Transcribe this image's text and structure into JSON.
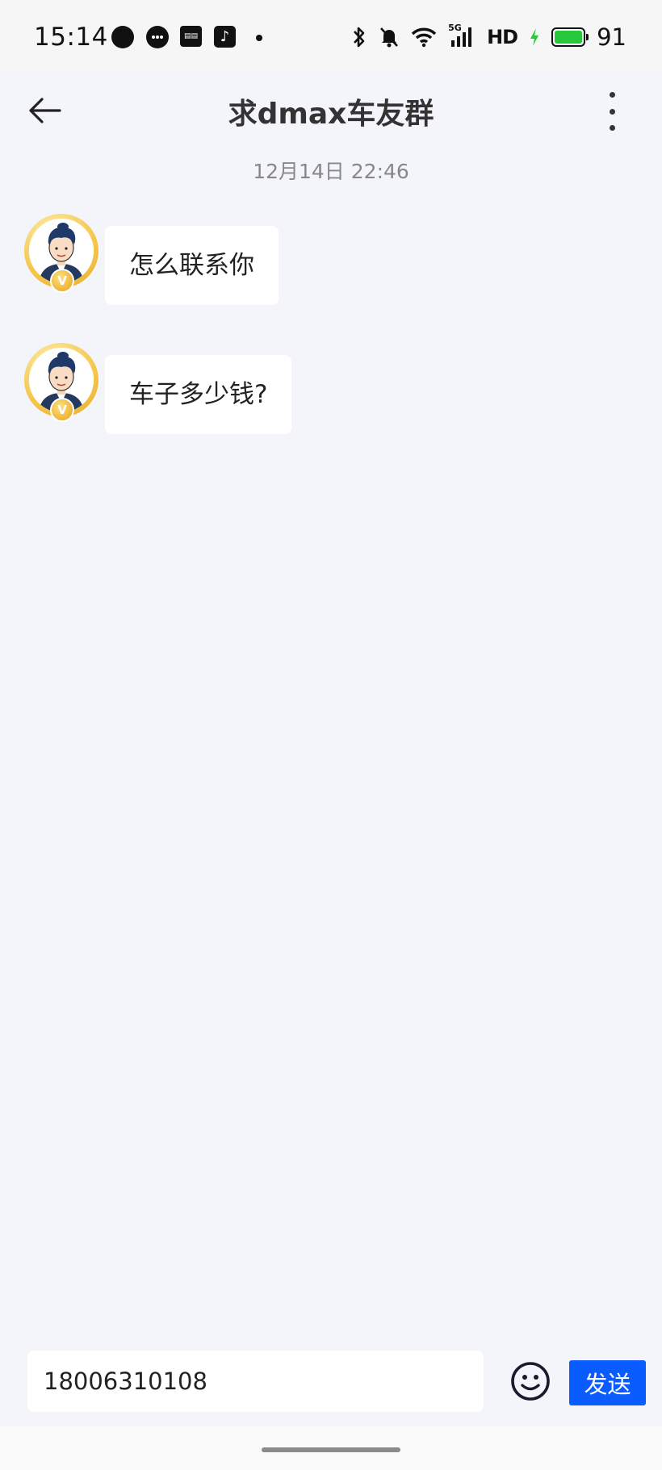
{
  "status_bar": {
    "time": "15:14",
    "notifications": [
      "chat-bubble-icon",
      "message-icon",
      "news-icon",
      "tiktok-icon",
      "more-dot-icon"
    ],
    "network": "5G",
    "hd_label": "HD",
    "battery_percent": "91",
    "battery_color": "#27c93a"
  },
  "header": {
    "title": "求dmax车友群",
    "back_icon": "back-arrow-icon",
    "more_icon": "more-vertical-icon"
  },
  "conversation": {
    "timestamp": "12月14日 22:46",
    "messages": [
      {
        "text": "怎么联系你",
        "badge": "V"
      },
      {
        "text": "车子多少钱?",
        "badge": "V"
      }
    ]
  },
  "composer": {
    "input_value": "18006310108",
    "emoji_icon": "smiley-icon",
    "send_label": "发送",
    "accent_color": "#0a5cff"
  }
}
